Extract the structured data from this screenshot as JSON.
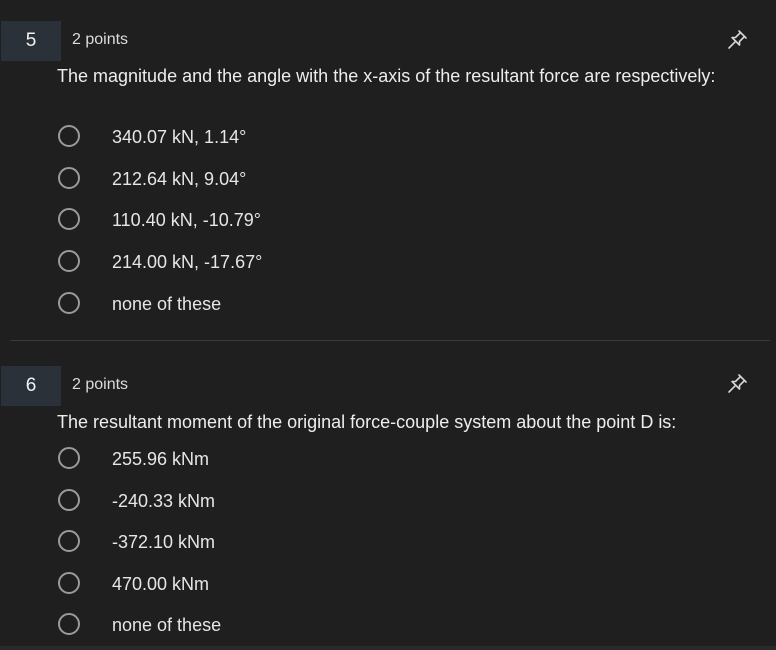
{
  "questions": [
    {
      "number": "5",
      "points": "2 points",
      "prompt": "The magnitude and the angle with the x-axis of the resultant force are respectively:",
      "pin_icon": "pin-icon",
      "options": [
        "340.07 kN,  1.14°",
        "212.64 kN, 9.04°",
        "110.40 kN, -10.79°",
        "214.00 kN, -17.67°",
        "none of these"
      ]
    },
    {
      "number": "6",
      "points": "2 points",
      "prompt": "The resultant moment of the original force-couple system about the point D is:",
      "pin_icon": "pin-icon",
      "options": [
        "255.96 kNm",
        "-240.33 kNm",
        "-372.10 kNm",
        "470.00 kNm",
        "none of these"
      ]
    }
  ],
  "colors": {
    "background": "#1f1f1f",
    "number_badge": "#2b3138",
    "radio_border": "#9a9a9a",
    "text": "#e6e6e6"
  }
}
